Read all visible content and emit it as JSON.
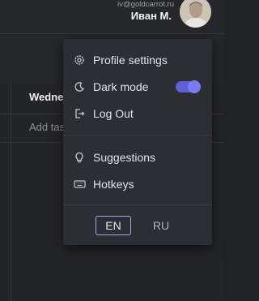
{
  "header": {
    "email": "iv@goldcarrot.ru",
    "name": "Иван М.",
    "avatar_icon": "user-avatar-photo"
  },
  "board": {
    "day_header": "Wednes",
    "add_task": "Add tas"
  },
  "menu": {
    "items": [
      {
        "label": "Profile settings",
        "icon": "gear-icon"
      },
      {
        "label": "Dark mode",
        "icon": "moon-icon",
        "toggle_on": true
      },
      {
        "label": "Log Out",
        "icon": "logout-icon"
      },
      {
        "label": "Suggestions",
        "icon": "lightbulb-icon"
      },
      {
        "label": "Hotkeys",
        "icon": "keyboard-icon"
      }
    ],
    "languages": [
      {
        "label": "EN",
        "active": true
      },
      {
        "label": "RU",
        "active": false
      }
    ]
  },
  "colors": {
    "accent": "#5f60d6",
    "menu_bg": "#2d2e33",
    "page_bg": "#212226"
  }
}
